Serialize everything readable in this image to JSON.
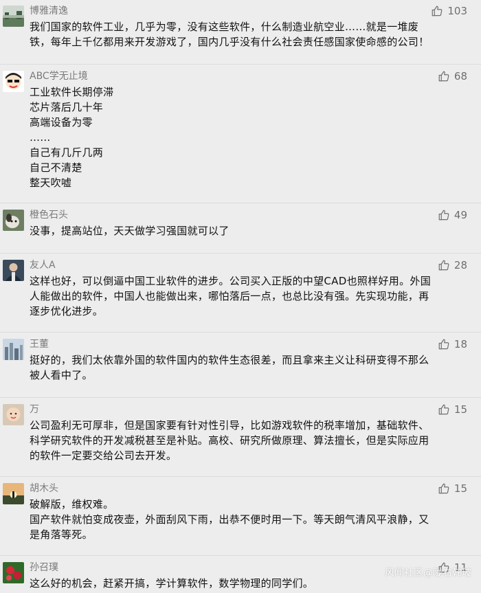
{
  "comments": [
    {
      "user": "博雅清逸",
      "likes": "103",
      "lines": [
        "我们国家的软件工业，几乎为零，没有这些软件，什么制造业航空业……就是一堆废",
        "铁，每年上千亿都用来开发游戏了，国内几乎没有什么社会责任感国家使命感的公司！"
      ],
      "avatar": "landscape"
    },
    {
      "user": "ABC学无止境",
      "likes": "68",
      "lines": [
        "工业软件长期停滞",
        "芯片落后几十年",
        "高端设备为零",
        "……",
        "自己有几斤几两",
        "自己不清楚",
        "整天吹嘘"
      ],
      "avatar": "cartoon"
    },
    {
      "user": "橙色石头",
      "likes": "49",
      "lines": [
        "没事，提高站位，天天做学习强国就可以了"
      ],
      "avatar": "dog"
    },
    {
      "user": "友人A",
      "likes": "28",
      "lines": [
        "这样也好，可以倒逼中国工业软件的进步。公司买入正版的中望CAD也照样好用。外国",
        "人能做出的软件，中国人也能做出来，哪怕落后一点，也总比没有强。先实现功能，再",
        "逐步优化进步。"
      ],
      "avatar": "person"
    },
    {
      "user": "王董",
      "likes": "18",
      "lines": [
        "挺好的，我们太依靠外国的软件国内的软件生态很差，而且拿来主义让科研变得不那么",
        "被人看中了。"
      ],
      "avatar": "city"
    },
    {
      "user": "万",
      "likes": "15",
      "lines": [
        "公司盈利无可厚非，但是国家要有针对性引导，比如游戏软件的税率增加，基础软件、",
        "科学研究软件的开发减税甚至是补贴。高校、研究所做原理、算法擅长，但是实际应用",
        "的软件一定要交给公司去开发。"
      ],
      "avatar": "baby"
    },
    {
      "user": "胡木头",
      "likes": "15",
      "lines": [
        "破解版，维权难。",
        "国产软件就怕变成夜壶，外面刮风下雨，出恭不便时用一下。等天朗气清风平浪静，又",
        "是角落等死。"
      ],
      "avatar": "sunset"
    },
    {
      "user": "孙召璞",
      "likes": "11",
      "lines": [
        "这么好的机会，赶紧开搞，学计算软件，数学物理的同学们。"
      ],
      "avatar": "flower"
    }
  ],
  "watermark": "风闻社区@陇右韩玻"
}
